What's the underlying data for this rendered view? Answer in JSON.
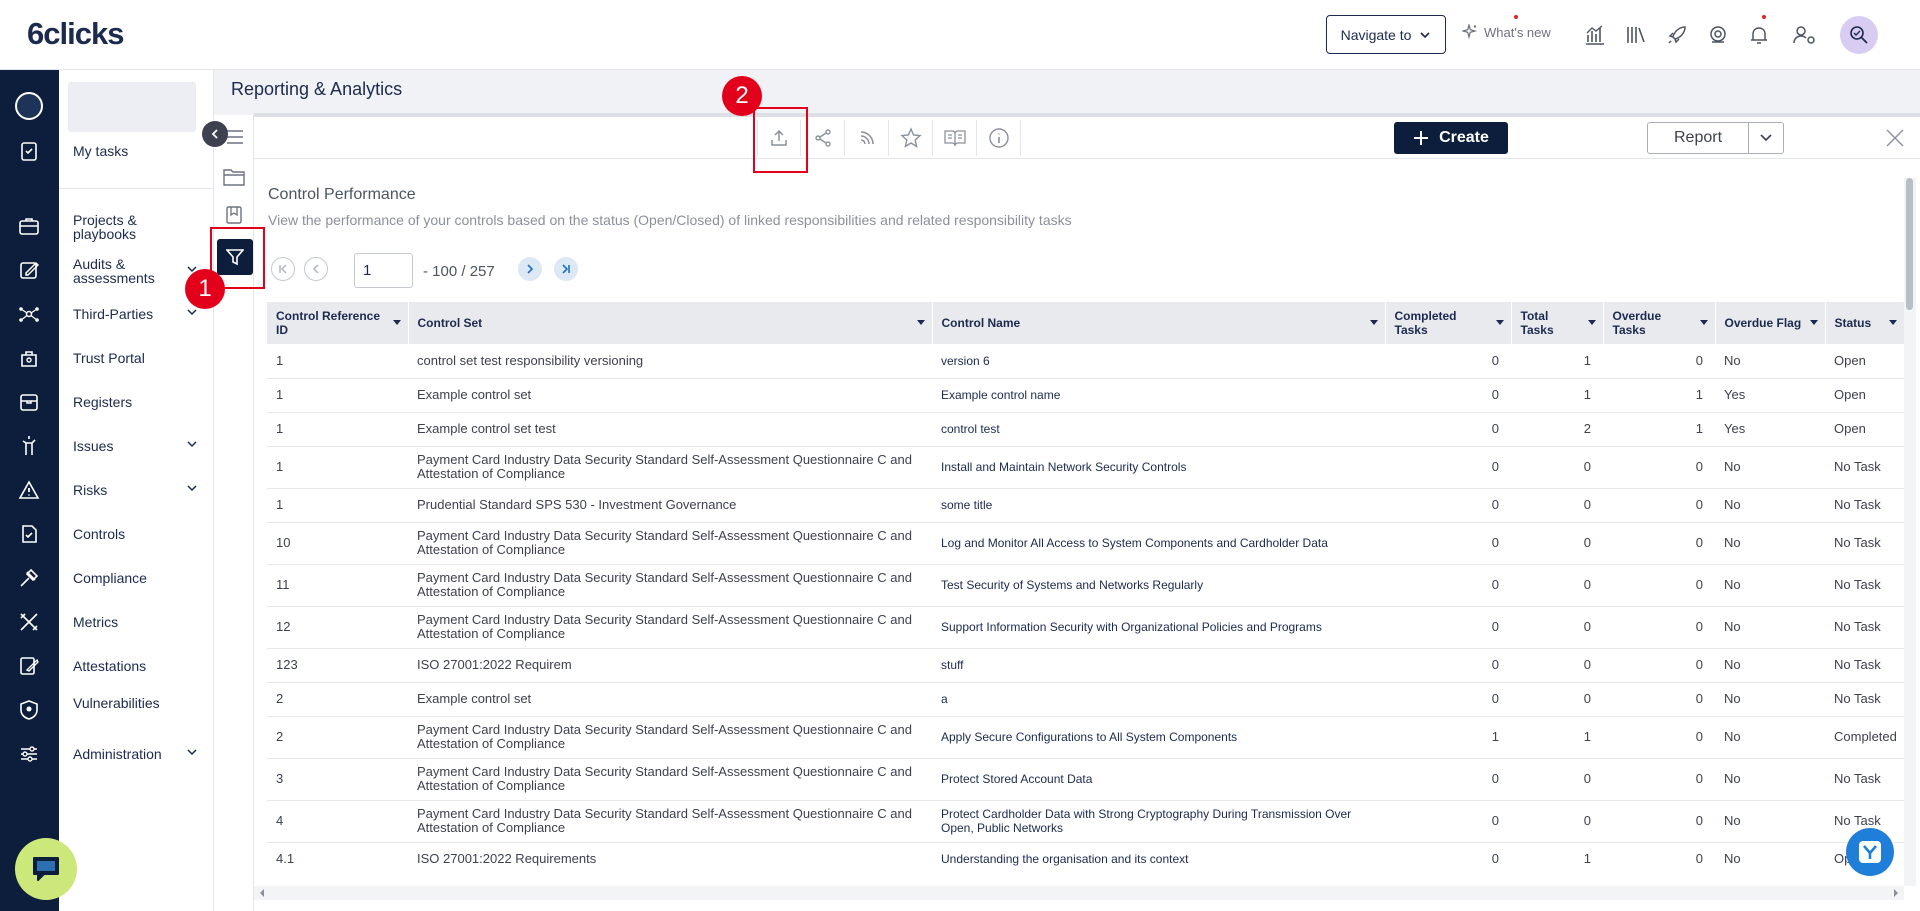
{
  "app": {
    "logo": "6clicks",
    "navigate_to": "Navigate to",
    "whats_new": "What's new"
  },
  "top_icons": [
    "chart-icon",
    "library-icon",
    "rocket-icon",
    "support-icon",
    "bell-icon",
    "user-settings-icon",
    "avatar-icon"
  ],
  "rail_icons": [
    "tasks-icon",
    "briefcase-icon",
    "edit-icon",
    "network-icon",
    "trust-icon",
    "registers-icon",
    "issues-icon",
    "risks-icon",
    "controls-icon",
    "compliance-icon",
    "metrics-icon",
    "attestations-icon",
    "vulnerabilities-icon",
    "administration-icon"
  ],
  "nav": {
    "my_tasks": "My tasks",
    "items": [
      {
        "label": "Projects & playbooks",
        "chevron": false
      },
      {
        "label": "Audits & assessments",
        "chevron": true
      },
      {
        "label": "Third-Parties",
        "chevron": true
      },
      {
        "label": "Trust Portal",
        "chevron": false
      },
      {
        "label": "Registers",
        "chevron": false
      },
      {
        "label": "Issues",
        "chevron": true
      },
      {
        "label": "Risks",
        "chevron": true
      },
      {
        "label": "Controls",
        "chevron": false
      },
      {
        "label": "Compliance",
        "chevron": false
      },
      {
        "label": "Metrics",
        "chevron": false
      },
      {
        "label": "Attestations",
        "chevron": false
      },
      {
        "label": "Vulnerabilities",
        "chevron": false
      },
      {
        "label": "Administration",
        "chevron": true
      }
    ]
  },
  "page": {
    "title": "Reporting & Analytics"
  },
  "toolbar": {
    "icons": [
      "export-icon",
      "share-icon",
      "rss-icon",
      "star-icon",
      "book-icon",
      "info-icon"
    ],
    "create_label": "Create",
    "report_label": "Report"
  },
  "annotations": {
    "first": "1",
    "second": "2"
  },
  "report": {
    "title": "Control Performance",
    "subtitle": "View the performance of your controls based on the status (Open/Closed) of linked responsibilities and related responsibility tasks",
    "pagination": {
      "page": "1",
      "range": "- 100 / 257"
    },
    "columns": [
      "Control Reference ID",
      "Control Set",
      "Control Name",
      "Completed Tasks",
      "Total Tasks",
      "Overdue Tasks",
      "Overdue Flag",
      "Status"
    ],
    "rows": [
      [
        "1",
        "control set test responsibility versioning",
        "version 6",
        "0",
        "1",
        "0",
        "No",
        "Open"
      ],
      [
        "1",
        "Example control set",
        "Example control name",
        "0",
        "1",
        "1",
        "Yes",
        "Open"
      ],
      [
        "1",
        "Example control set test",
        "control test",
        "0",
        "2",
        "1",
        "Yes",
        "Open"
      ],
      [
        "1",
        "Payment Card Industry Data Security Standard Self-Assessment Questionnaire C and Attestation of Compliance",
        "Install and Maintain Network Security Controls",
        "0",
        "0",
        "0",
        "No",
        "No Task"
      ],
      [
        "1",
        "Prudential Standard SPS 530 - Investment Governance",
        "some title",
        "0",
        "0",
        "0",
        "No",
        "No Task"
      ],
      [
        "10",
        "Payment Card Industry Data Security Standard Self-Assessment Questionnaire C and Attestation of Compliance",
        "Log and Monitor All Access to System Components and Cardholder Data",
        "0",
        "0",
        "0",
        "No",
        "No Task"
      ],
      [
        "11",
        "Payment Card Industry Data Security Standard Self-Assessment Questionnaire C and Attestation of Compliance",
        "Test Security of Systems and Networks Regularly",
        "0",
        "0",
        "0",
        "No",
        "No Task"
      ],
      [
        "12",
        "Payment Card Industry Data Security Standard Self-Assessment Questionnaire C and Attestation of Compliance",
        "Support Information Security with Organizational Policies and Programs",
        "0",
        "0",
        "0",
        "No",
        "No Task"
      ],
      [
        "123",
        "ISO 27001:2022 Requirem",
        "stuff",
        "0",
        "0",
        "0",
        "No",
        "No Task"
      ],
      [
        "2",
        "Example control set",
        "a",
        "0",
        "0",
        "0",
        "No",
        "No Task"
      ],
      [
        "2",
        "Payment Card Industry Data Security Standard Self-Assessment Questionnaire C and Attestation of Compliance",
        "Apply Secure Configurations to All System Components",
        "1",
        "1",
        "0",
        "No",
        "Completed"
      ],
      [
        "3",
        "Payment Card Industry Data Security Standard Self-Assessment Questionnaire C and Attestation of Compliance",
        "Protect Stored Account Data",
        "0",
        "0",
        "0",
        "No",
        "No Task"
      ],
      [
        "4",
        "Payment Card Industry Data Security Standard Self-Assessment Questionnaire C and Attestation of Compliance",
        "Protect Cardholder Data with Strong Cryptography During Transmission Over Open, Public Networks",
        "0",
        "0",
        "0",
        "No",
        "No Task"
      ],
      [
        "4.1",
        "ISO 27001:2022 Requirements",
        "Understanding the organisation and its context",
        "0",
        "1",
        "0",
        "No",
        "Open"
      ]
    ]
  },
  "colors": {
    "navy": "#0c1e3c",
    "annotation_red": "#e3001b",
    "chat_green": "#cde87a",
    "help_blue": "#1f7fd8"
  }
}
